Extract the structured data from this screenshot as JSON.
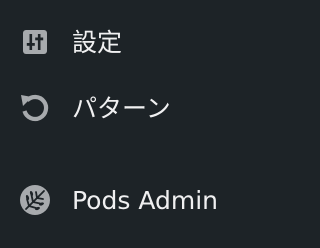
{
  "sidebar": {
    "items": [
      {
        "label": "設定",
        "icon": "settings-sliders-icon"
      },
      {
        "label": "パターン",
        "icon": "undo-icon"
      },
      {
        "label": "Pods Admin",
        "icon": "pods-logo-icon"
      }
    ]
  },
  "colors": {
    "background": "#1d2327",
    "text": "#f0f0f1",
    "icon": "#a7aaad"
  }
}
